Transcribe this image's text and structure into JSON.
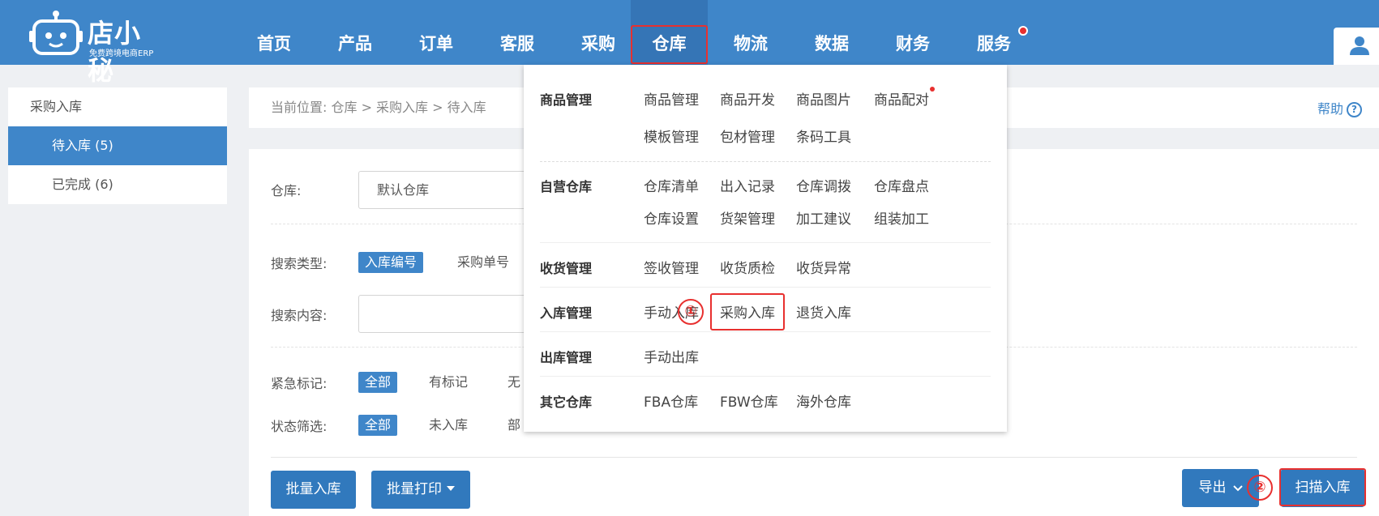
{
  "brand": {
    "name": "店小秘",
    "subtitle": "免费跨境电商ERP"
  },
  "nav": {
    "items": [
      {
        "label": "首页"
      },
      {
        "label": "产品"
      },
      {
        "label": "订单"
      },
      {
        "label": "客服"
      },
      {
        "label": "采购"
      },
      {
        "label": "仓库"
      },
      {
        "label": "物流"
      },
      {
        "label": "数据"
      },
      {
        "label": "财务"
      },
      {
        "label": "服务"
      }
    ],
    "active": "仓库"
  },
  "sidebar": {
    "header": "采购入库",
    "items": [
      {
        "label": "待入库 (5)",
        "active": true
      },
      {
        "label": "已完成 (6)",
        "active": false
      }
    ]
  },
  "breadcrumb": {
    "text": "当前位置:  仓库 > 采购入库 > 待入库"
  },
  "help": {
    "label": "帮助",
    "icon_glyph": "?"
  },
  "filters": {
    "warehouse_label": "仓库:",
    "warehouse_value": "默认仓库",
    "search_type_label": "搜索类型:",
    "search_types": [
      "入库编号",
      "采购单号"
    ],
    "search_content_label": "搜索内容:",
    "urgent_label": "紧急标记:",
    "urgent_options": [
      "全部",
      "有标记",
      "无"
    ],
    "status_label": "状态筛选:",
    "status_options": [
      "全部",
      "未入库",
      "部"
    ]
  },
  "actions": {
    "batch_inbound": "批量入库",
    "batch_print": "批量打印",
    "export": "导出",
    "scan_inbound": "扫描入库"
  },
  "annotations": {
    "circle_1": "①",
    "circle_2": "②"
  },
  "dropdown": {
    "groups": [
      {
        "category": "商品管理",
        "items": [
          "商品管理",
          "商品开发",
          "商品图片",
          "商品配对",
          "模板管理",
          "包材管理",
          "条码工具"
        ]
      },
      {
        "category": "自营仓库",
        "items": [
          "仓库清单",
          "出入记录",
          "仓库调拨",
          "仓库盘点",
          "仓库设置",
          "货架管理",
          "加工建议",
          "组装加工"
        ]
      },
      {
        "category": "收货管理",
        "items": [
          "签收管理",
          "收货质检",
          "收货异常"
        ]
      },
      {
        "category": "入库管理",
        "items": [
          "手动入库",
          "采购入库",
          "退货入库"
        ]
      },
      {
        "category": "出库管理",
        "items": [
          "手动出库"
        ]
      },
      {
        "category": "其它仓库",
        "items": [
          "FBA仓库",
          "FBW仓库",
          "海外仓库"
        ]
      }
    ]
  },
  "colors": {
    "primary": "#3f86c9",
    "highlight": "#e8302f"
  }
}
